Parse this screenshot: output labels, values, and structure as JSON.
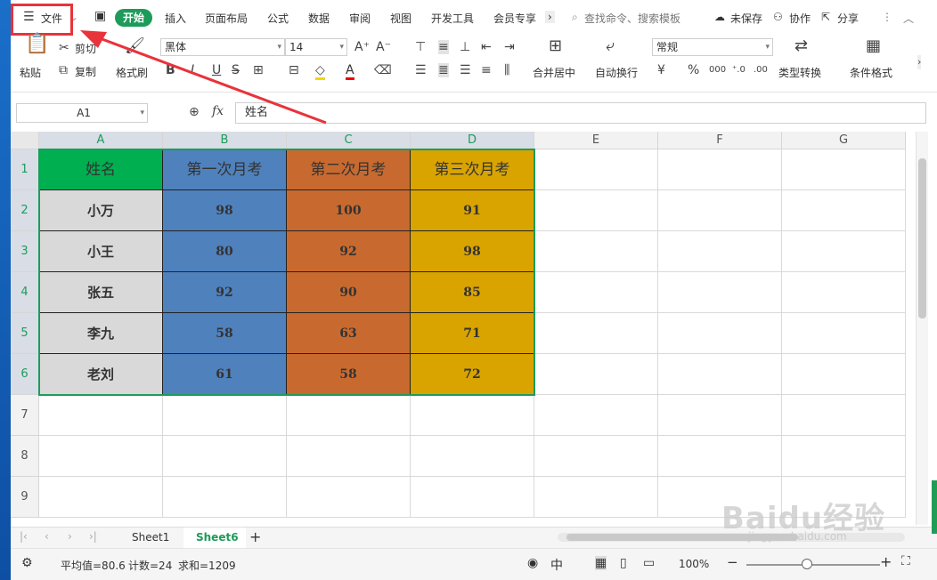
{
  "tabs": {
    "menu_label": "文件",
    "items": [
      "开始",
      "插入",
      "页面布局",
      "公式",
      "数据",
      "审阅",
      "视图",
      "开发工具",
      "会员专享"
    ],
    "search_placeholder": "查找命令、搜索模板",
    "unsaved": "未保存",
    "collab": "协作",
    "share": "分享"
  },
  "ribbon": {
    "paste": "粘贴",
    "cut": "剪切",
    "copy": "复制",
    "format_painter": "格式刷",
    "font_name": "黑体",
    "font_size": "14",
    "merge_center": "合并居中",
    "wrap_text": "自动换行",
    "number_format": "常规",
    "currency": "¥",
    "percent": "%",
    "type_convert": "类型转换",
    "cond_format": "条件格式",
    "bold": "B",
    "italic": "I",
    "underline": "U"
  },
  "formula_bar": {
    "name_box": "A1",
    "fx": "fx",
    "content": "姓名"
  },
  "grid": {
    "columns": [
      "A",
      "B",
      "C",
      "D",
      "E",
      "F",
      "G"
    ],
    "rows": [
      "1",
      "2",
      "3",
      "4",
      "5",
      "6",
      "7",
      "8",
      "9"
    ],
    "table": {
      "headers": [
        "姓名",
        "第一次月考",
        "第二次月考",
        "第三次月考"
      ],
      "data": [
        [
          "小万",
          "98",
          "100",
          "91"
        ],
        [
          "小王",
          "80",
          "92",
          "98"
        ],
        [
          "张五",
          "92",
          "90",
          "85"
        ],
        [
          "李九",
          "58",
          "63",
          "71"
        ],
        [
          "老刘",
          "61",
          "58",
          "72"
        ]
      ]
    },
    "colors": {
      "name_header": "#00b050",
      "name_col": "#d9d9d9",
      "col_b": "#4f81bd",
      "col_c": "#c86a2f",
      "col_d": "#d9a400",
      "selection": "#1e9b5a"
    }
  },
  "sheets": {
    "tabs": [
      "Sheet1",
      "Sheet6"
    ],
    "active": "Sheet6"
  },
  "status": {
    "average": "平均值=80.6",
    "count": "计数=24",
    "sum": "求和=1209",
    "zoom": "100%"
  },
  "watermark": {
    "brand": "Baidu经验",
    "url": "jingyan.baidu.com"
  }
}
